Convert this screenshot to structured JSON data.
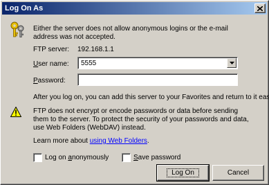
{
  "window": {
    "title": "Log On As",
    "close_glyph": "✕"
  },
  "intro": {
    "text": "Either the server does not allow anonymous logins or the e-mail address was not accepted."
  },
  "ftp_server": {
    "label": "FTP server:",
    "value": "192.168.1.1"
  },
  "user_name": {
    "label_prefix": "",
    "label_underlined": "U",
    "label_rest": "ser name:",
    "value": "5555"
  },
  "password": {
    "label_underlined": "P",
    "label_rest": "assword:",
    "value": ""
  },
  "after_logon": {
    "text": "After you log on, you can add this server to your Favorites and return to it easily."
  },
  "warning": {
    "text": "FTP does not encrypt or encode passwords or data before sending them to the server.  To protect the security of your passwords and data, use Web Folders (WebDAV) instead."
  },
  "learn_more": {
    "prefix": "Learn more about ",
    "link": "using Web Folders",
    "suffix": "."
  },
  "anonymous": {
    "prefix": "Log on ",
    "underlined": "a",
    "rest": "nonymously",
    "checked": false
  },
  "save_password": {
    "underlined": "S",
    "rest": "ave password",
    "checked": false
  },
  "buttons": {
    "log_on": "Log On",
    "cancel": "Cancel"
  },
  "icons": {
    "keys": "keys-icon",
    "warning": "warning-icon",
    "dropdown": "chevron-down-icon",
    "close": "close-icon"
  },
  "colors": {
    "title_start": "#0a246a",
    "title_end": "#a6caf0",
    "dialog_face": "#d4d0c8",
    "link": "#0000ff",
    "warning_yellow": "#ffff00"
  }
}
